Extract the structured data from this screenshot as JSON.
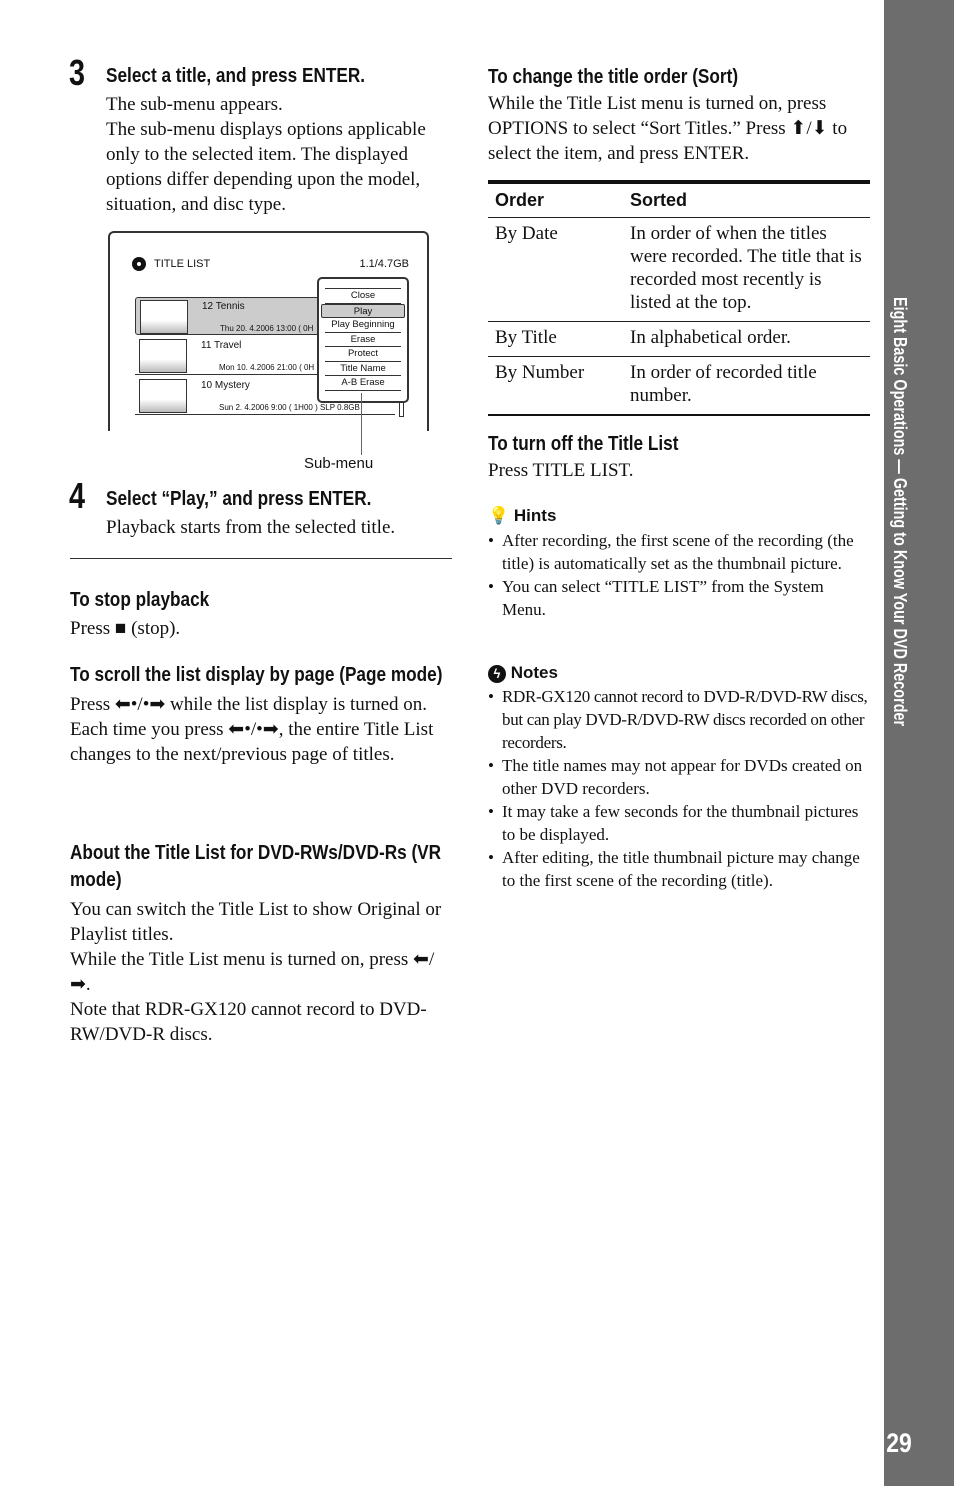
{
  "step3": {
    "num": "3",
    "title": "Select a title, and press ENTER.",
    "lines": [
      "The sub-menu appears.",
      "The sub-menu displays options applicable only to the selected item. The displayed options differ depending upon the model, situation, and disc type."
    ]
  },
  "screen": {
    "title": "TITLE LIST",
    "capacity": "1.1/4.7GB",
    "rows": [
      {
        "name": "12  Tennis",
        "info": "Thu   20. 4.2006    13:00 (  0H"
      },
      {
        "name": "11  Travel",
        "info": "Mon  10. 4.2006    21:00 (  0H"
      },
      {
        "name": "10  Mystery",
        "info": "Sun    2. 4.2006     9:00 (  1H00   ) SLP 0.8GB"
      }
    ],
    "menu": [
      "Close",
      "Play",
      "Play Beginning",
      "Erase",
      "Protect",
      "Title Name",
      "A-B Erase"
    ],
    "callout": "Sub-menu"
  },
  "step4": {
    "num": "4",
    "title": "Select “Play,” and press ENTER.",
    "text": "Playback starts from the selected title."
  },
  "stop": {
    "title": "To stop playback",
    "text": "Press ■ (stop)."
  },
  "scroll": {
    "title": "To scroll the list display by page (Page mode)",
    "text": "Press ⬅•/•➡ while the list display is turned on. Each time you press ⬅•/•➡, the entire Title List changes to the next/previous page of titles."
  },
  "about": {
    "title": "About the Title List for DVD-RWs/DVD-Rs (VR mode)",
    "text1": "You can switch the Title List to show Original or Playlist titles.",
    "text2": "While the Title List menu is turned on, press ⬅/➡.",
    "text3": "Note that RDR-GX120 cannot record to DVD-RW/DVD-R discs."
  },
  "sort": {
    "title": "To change the title order (Sort)",
    "text": "While the Title List menu is turned on, press OPTIONS to select “Sort Titles.” Press ⬆/⬇ to select the item, and press ENTER.",
    "headers": [
      "Order",
      "Sorted"
    ],
    "rows": [
      [
        "By Date",
        "In order of when the titles were recorded. The title that is recorded most recently is listed at the top."
      ],
      [
        "By Title",
        "In alphabetical order."
      ],
      [
        "By Number",
        "In order of recorded title number."
      ]
    ]
  },
  "off": {
    "title": "To turn off the Title List",
    "text": "Press TITLE LIST."
  },
  "hints": {
    "title": "Hints",
    "items": [
      "After recording, the first scene of the recording (the title) is automatically set as the thumbnail picture.",
      "You can select “TITLE LIST” from the System Menu."
    ]
  },
  "notes": {
    "title": "Notes",
    "items": [
      "RDR-GX120 cannot record to DVD-R/DVD-RW discs, but can play DVD-R/DVD-RW discs recorded on other recorders.",
      "The title names may not appear for DVDs created on other DVD recorders.",
      "It may take a few seconds for the thumbnail pictures to be displayed.",
      "After editing, the title thumbnail picture may change to the first scene of the recording (title)."
    ]
  },
  "sidetab": {
    "text": "Eight Basic Operations — Getting to Know Your DVD Recorder",
    "page": "29",
    "color": "#6d6d6d"
  }
}
